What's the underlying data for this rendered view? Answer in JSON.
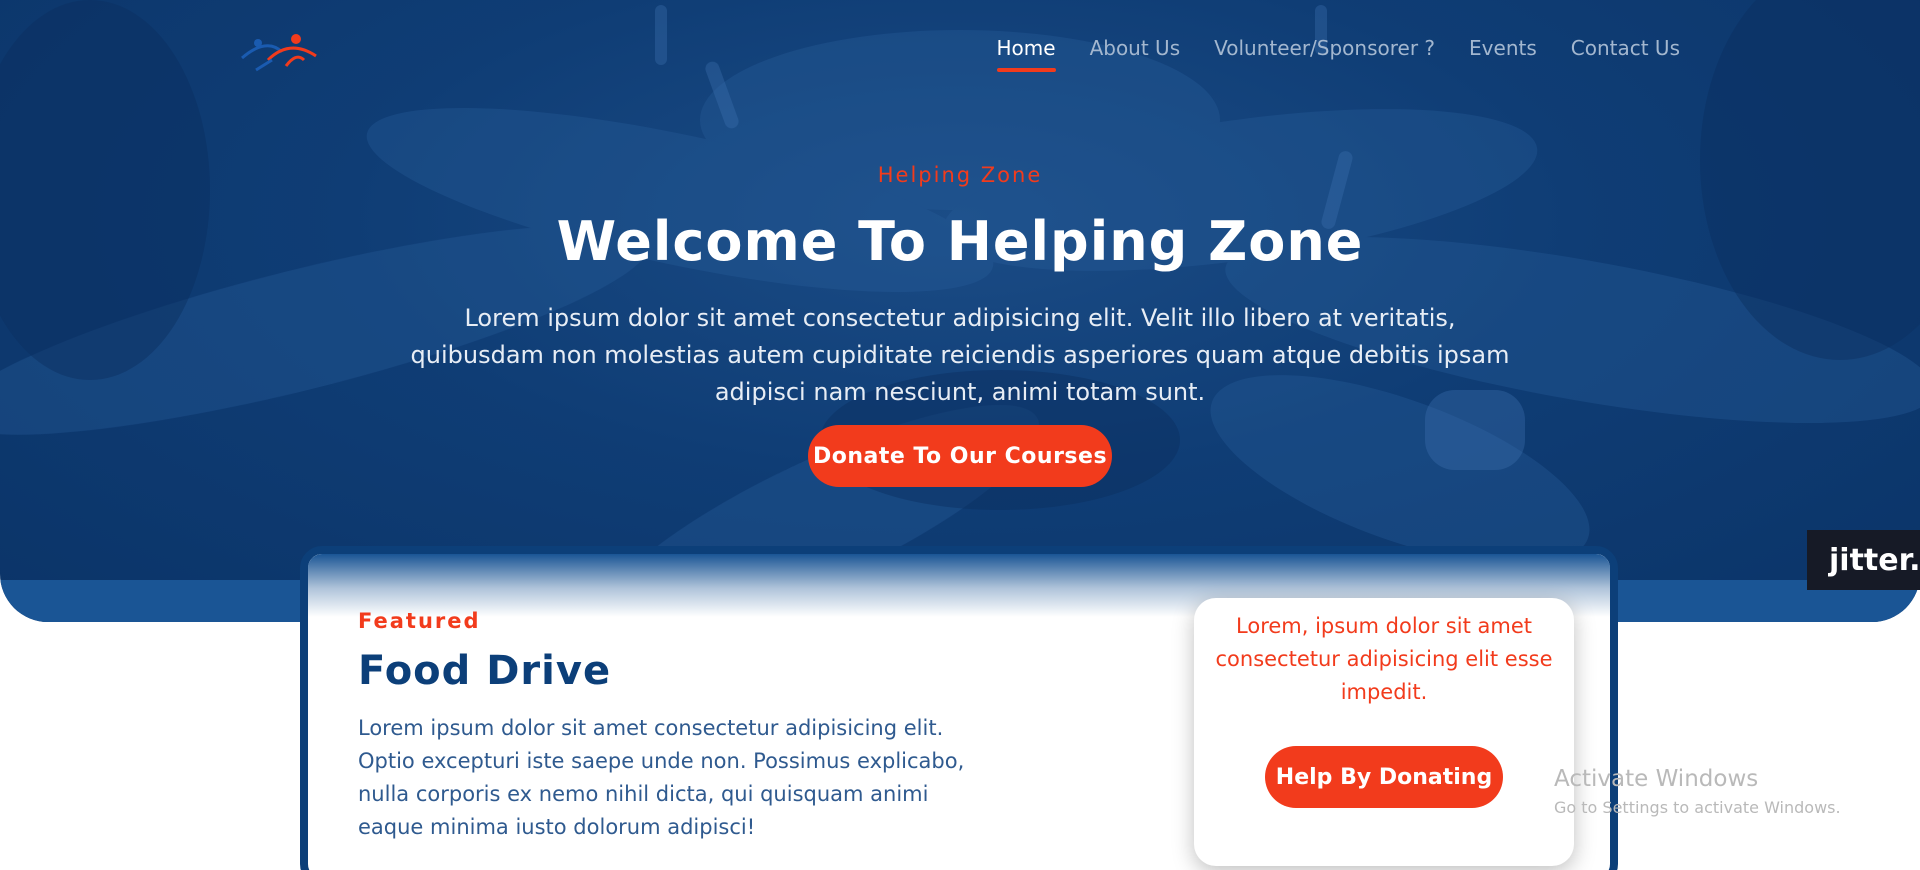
{
  "nav": {
    "items": [
      {
        "label": "Home",
        "active": true
      },
      {
        "label": "About Us"
      },
      {
        "label": "Volunteer/Sponsorer ?"
      },
      {
        "label": "Events"
      },
      {
        "label": "Contact Us"
      }
    ]
  },
  "hero": {
    "kicker": "Helping Zone",
    "title": "Welcome To Helping Zone",
    "description": "Lorem ipsum dolor sit amet consectetur adipisicing elit. Velit illo libero at veritatis, quibusdam non molestias autem cupiditate reiciendis asperiores quam atque debitis ipsam adipisci nam nesciunt, animi totam sunt.",
    "button_label": "Donate To Our Courses"
  },
  "featured": {
    "kicker": "Featured",
    "title": "Food Drive",
    "description": "Lorem ipsum dolor sit amet consectetur adipisicing elit. Optio excepturi iste saepe unde non. Possimus explicabo, nulla corporis ex nemo nihil dicta, qui quisquam animi eaque minima iusto dolorum adipisci!",
    "donate_box": {
      "text": "Lorem, ipsum dolor sit amet consectetur adipisicing elit esse impedit.",
      "button_label": "Help By Donating"
    }
  },
  "overlays": {
    "jitter_badge": "jitter.v",
    "watermark_title": "Activate Windows",
    "watermark_subtitle": "Go to Settings to activate Windows."
  },
  "colors": {
    "primary_blue": "#0c3f79",
    "accent_orange": "#f23b1c",
    "hero_bg": "#0f3d75",
    "nav_inactive": "#a3b7cf"
  }
}
